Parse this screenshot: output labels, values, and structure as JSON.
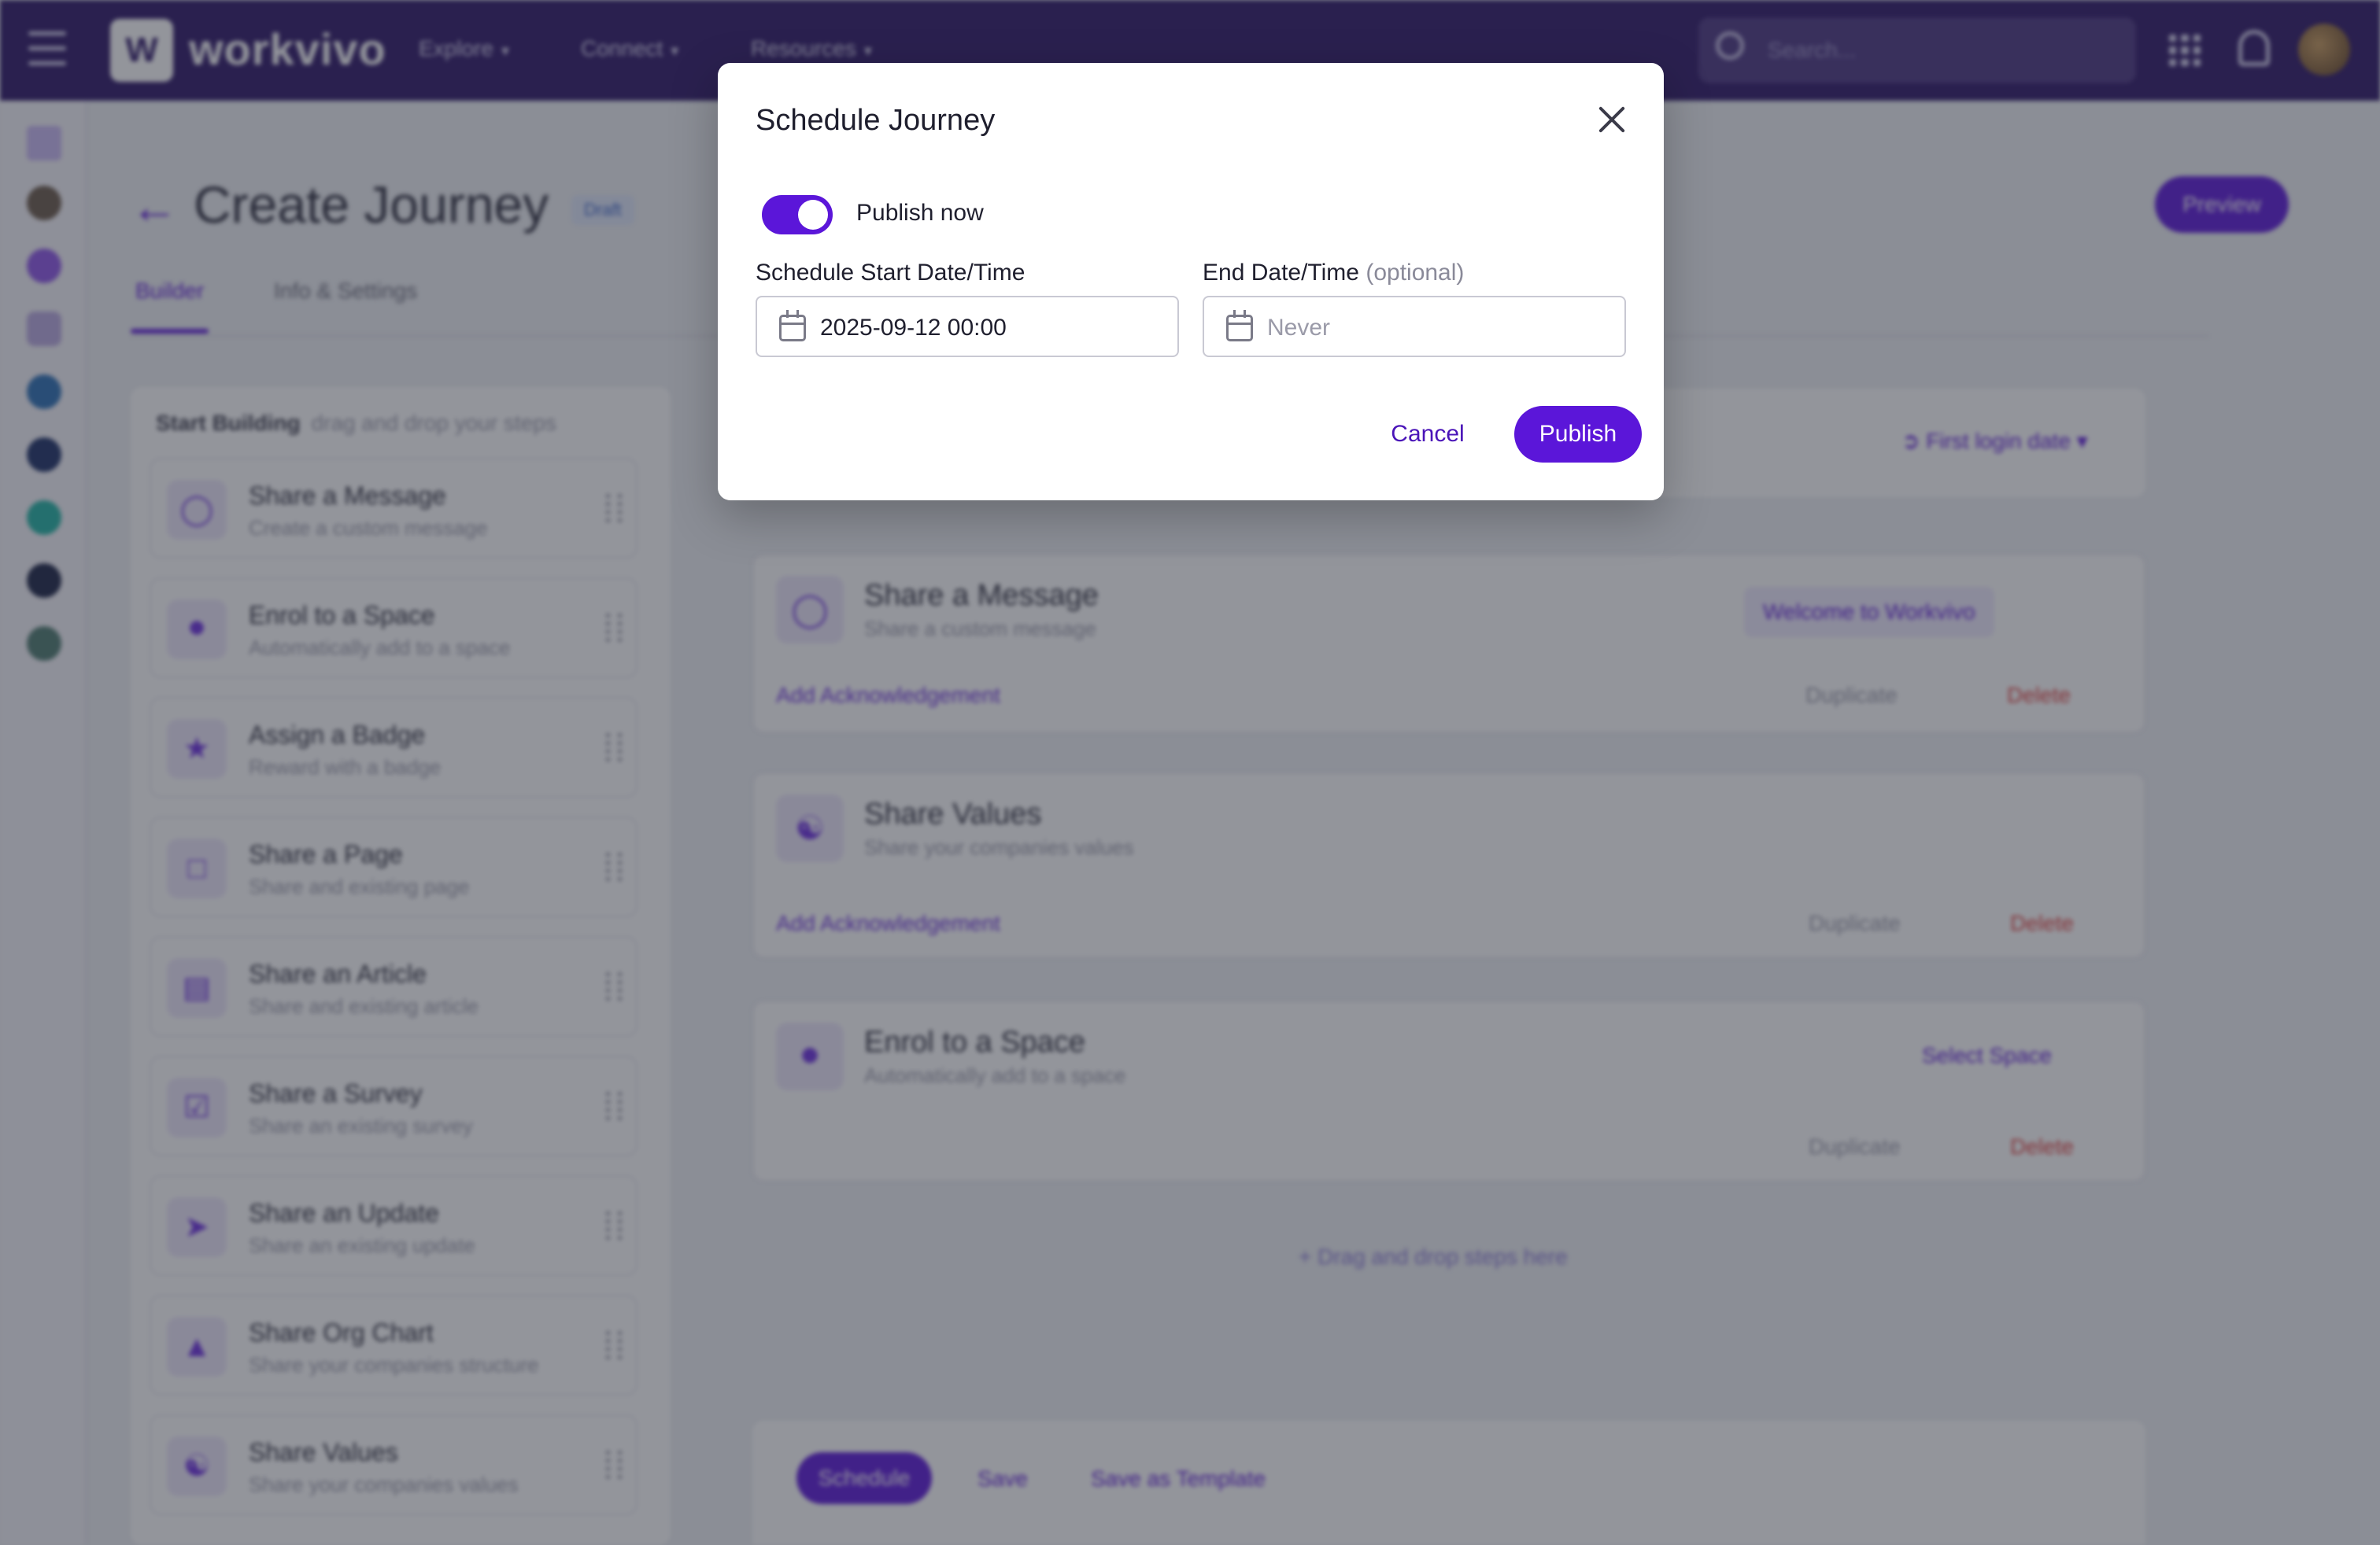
{
  "app": {
    "brand": "workvivo",
    "logo_glyph": "W",
    "nav": [
      {
        "label": "Explore"
      },
      {
        "label": "Connect"
      },
      {
        "label": "Resources"
      }
    ],
    "search_placeholder": "Search..."
  },
  "page": {
    "title": "Create Journey",
    "status_badge": "Draft",
    "preview_label": "Preview",
    "tabs": [
      {
        "label": "Builder",
        "active": true
      },
      {
        "label": "Info & Settings",
        "active": false
      }
    ]
  },
  "palette": {
    "heading": "Start Building",
    "subheading": "drag and drop your steps",
    "items": [
      {
        "title": "Share a Message",
        "subtitle": "Create a custom message",
        "icon": "message-icon"
      },
      {
        "title": "Enrol to a Space",
        "subtitle": "Automatically add to a space",
        "icon": "space-icon"
      },
      {
        "title": "Assign a Badge",
        "subtitle": "Reward with a badge",
        "icon": "badge-icon"
      },
      {
        "title": "Share a Page",
        "subtitle": "Share and existing page",
        "icon": "page-icon"
      },
      {
        "title": "Share an Article",
        "subtitle": "Share and existing article",
        "icon": "article-icon"
      },
      {
        "title": "Share a Survey",
        "subtitle": "Share an existing survey",
        "icon": "survey-icon"
      },
      {
        "title": "Share an Update",
        "subtitle": "Share an existing update",
        "icon": "update-icon"
      },
      {
        "title": "Share Org Chart",
        "subtitle": "Share your companies structure",
        "icon": "org-chart-icon"
      },
      {
        "title": "Share Values",
        "subtitle": "Share your companies values",
        "icon": "values-icon"
      }
    ]
  },
  "timeline": {
    "trigger_label": "First login date"
  },
  "steps": [
    {
      "title": "Share a Message",
      "subtitle": "Share a custom message",
      "chip": "Welcome to Workvivo",
      "ack": "Add Acknowledgement",
      "duplicate": "Duplicate",
      "delete": "Delete"
    },
    {
      "title": "Share Values",
      "subtitle": "Share your companies values",
      "chip": "",
      "ack": "Add Acknowledgement",
      "duplicate": "Duplicate",
      "delete": "Delete"
    },
    {
      "title": "Enrol to a Space",
      "subtitle": "Automatically add to a space",
      "chip": "Select Space",
      "ack": "",
      "duplicate": "Duplicate",
      "delete": "Delete"
    }
  ],
  "drag_hint": "Drag and drop steps here",
  "bottom_bar": {
    "schedule": "Schedule",
    "save": "Save",
    "save_template": "Save as Template"
  },
  "modal": {
    "title": "Schedule Journey",
    "publish_now_label": "Publish now",
    "publish_now_on": true,
    "start_label": "Schedule Start Date/Time",
    "start_value": "2025-09-12 00:00",
    "end_label": "End Date/Time",
    "end_optional": "(optional)",
    "end_placeholder": "Never",
    "cancel_label": "Cancel",
    "publish_label": "Publish"
  },
  "colors": {
    "brand_purple": "#5b16d9",
    "topbar": "#2c1466",
    "danger": "#e03a3a"
  }
}
